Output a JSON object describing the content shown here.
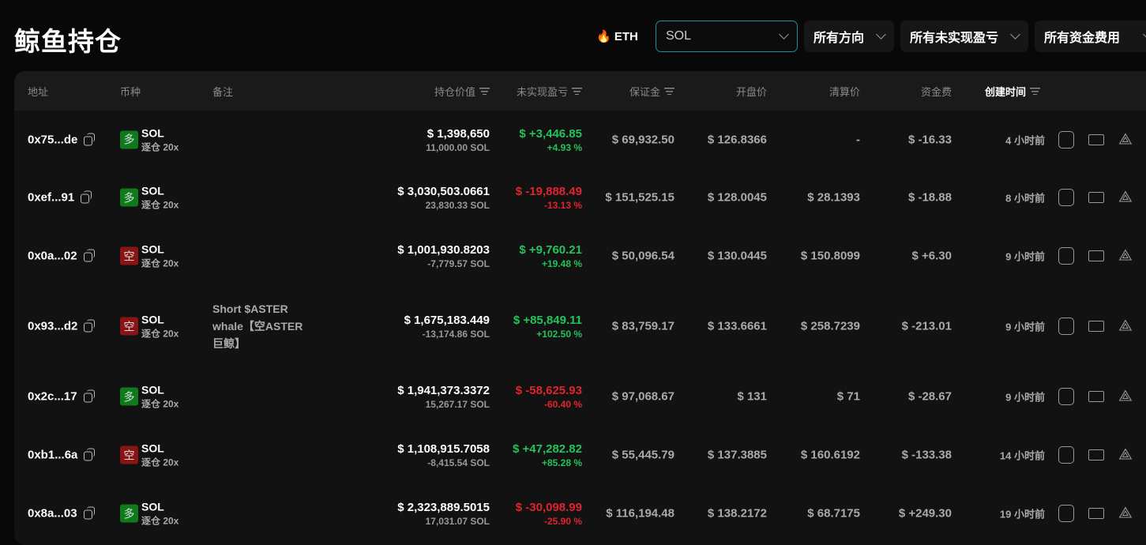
{
  "title": "鲸鱼持仓",
  "filters": {
    "eth": "🔥 ETH",
    "coin": "SOL",
    "direction": "所有方向",
    "pnl": "所有未实现盈亏",
    "funding": "所有资金费用"
  },
  "headers": {
    "address": "地址",
    "coin": "币种",
    "note": "备注",
    "value": "持仓价值",
    "pnl": "未实现盈亏",
    "margin": "保证金",
    "open": "开盘价",
    "liq": "清算价",
    "funding": "资金费",
    "created": "创建时间"
  },
  "colors": {
    "green": "#23c35a",
    "red": "#e0242c",
    "accent": "#1f8a98"
  },
  "rows": [
    {
      "address": "0x75...de",
      "side": "多",
      "dir": "long",
      "coin": "SOL",
      "mode": "逐仓 20x",
      "note": "",
      "value": "$ 1,398,650",
      "qty": "11,000.00 SOL",
      "pnl": "$ +3,446.85",
      "pnl_pct": "+4.93 %",
      "pnl_pos": true,
      "margin": "$ 69,932.50",
      "open": "$ 126.8366",
      "liq": "-",
      "funding": "$ -16.33",
      "funding_pos": false,
      "time": "4 小时前"
    },
    {
      "address": "0xef...91",
      "side": "多",
      "dir": "long",
      "coin": "SOL",
      "mode": "逐仓 20x",
      "note": "",
      "value": "$ 3,030,503.0661",
      "qty": "23,830.33 SOL",
      "pnl": "$ -19,888.49",
      "pnl_pct": "-13.13 %",
      "pnl_pos": false,
      "margin": "$ 151,525.15",
      "open": "$ 128.0045",
      "liq": "$ 28.1393",
      "funding": "$ -18.88",
      "funding_pos": false,
      "time": "8 小时前"
    },
    {
      "address": "0x0a...02",
      "side": "空",
      "dir": "short",
      "coin": "SOL",
      "mode": "逐仓 20x",
      "note": "",
      "value": "$ 1,001,930.8203",
      "qty": "-7,779.57 SOL",
      "pnl": "$ +9,760.21",
      "pnl_pct": "+19.48 %",
      "pnl_pos": true,
      "margin": "$ 50,096.54",
      "open": "$ 130.0445",
      "liq": "$ 150.8099",
      "funding": "$ +6.30",
      "funding_pos": true,
      "time": "9 小时前"
    },
    {
      "address": "0x93...d2",
      "side": "空",
      "dir": "short",
      "coin": "SOL",
      "mode": "逐仓 20x",
      "note": "Short $ASTER whale【空ASTER巨鲸】",
      "value": "$ 1,675,183.449",
      "qty": "-13,174.86 SOL",
      "pnl": "$ +85,849.11",
      "pnl_pct": "+102.50 %",
      "pnl_pos": true,
      "margin": "$ 83,759.17",
      "open": "$ 133.6661",
      "liq": "$ 258.7239",
      "funding": "$ -213.01",
      "funding_pos": false,
      "time": "9 小时前"
    },
    {
      "address": "0x2c...17",
      "side": "多",
      "dir": "long",
      "coin": "SOL",
      "mode": "逐仓 20x",
      "note": "",
      "value": "$ 1,941,373.3372",
      "qty": "15,267.17 SOL",
      "pnl": "$ -58,625.93",
      "pnl_pct": "-60.40 %",
      "pnl_pos": false,
      "margin": "$ 97,068.67",
      "open": "$ 131",
      "liq": "$ 71",
      "funding": "$ -28.67",
      "funding_pos": false,
      "time": "9 小时前"
    },
    {
      "address": "0xb1...6a",
      "side": "空",
      "dir": "short",
      "coin": "SOL",
      "mode": "逐仓 20x",
      "note": "",
      "value": "$ 1,108,915.7058",
      "qty": "-8,415.54 SOL",
      "pnl": "$ +47,282.82",
      "pnl_pct": "+85.28 %",
      "pnl_pos": true,
      "margin": "$ 55,445.79",
      "open": "$ 137.3885",
      "liq": "$ 160.6192",
      "funding": "$ -133.38",
      "funding_pos": false,
      "time": "14 小时前"
    },
    {
      "address": "0x8a...03",
      "side": "多",
      "dir": "long",
      "coin": "SOL",
      "mode": "逐仓 20x",
      "note": "",
      "value": "$ 2,323,889.5015",
      "qty": "17,031.07 SOL",
      "pnl": "$ -30,098.99",
      "pnl_pct": "-25.90 %",
      "pnl_pos": false,
      "margin": "$ 116,194.48",
      "open": "$ 138.2172",
      "liq": "$ 68.7175",
      "funding": "$ +249.30",
      "funding_pos": true,
      "time": "19 小时前"
    }
  ]
}
